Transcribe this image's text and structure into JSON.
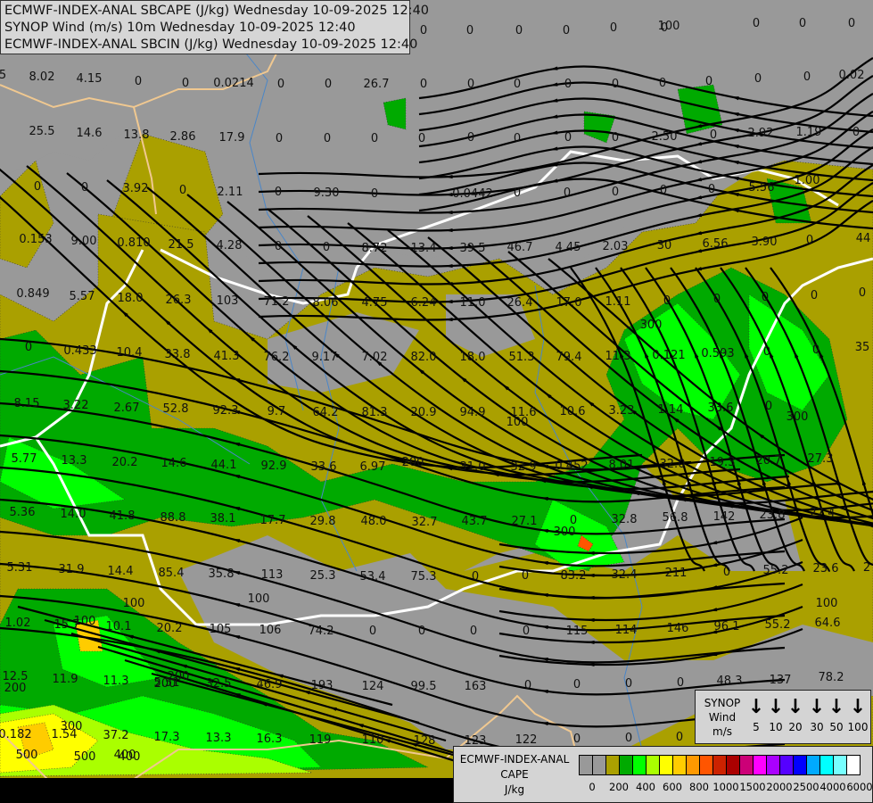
{
  "header": {
    "lines": [
      "ECMWF-INDEX-ANAL SBCAPE (J/kg) Wednesday 10-09-2025 12:40",
      "SYNOP Wind (m/s) 10m Wednesday 10-09-2025 12:40",
      "ECMWF-INDEX-ANAL SBCIN (J/kg) Wednesday 10-09-2025 12:40"
    ]
  },
  "wind_legend": {
    "title": [
      "SYNOP",
      "Wind",
      "m/s"
    ],
    "speeds": [
      "5",
      "10",
      "20",
      "30",
      "50",
      "100"
    ],
    "icon": "wind-arrow-down-icon"
  },
  "cape_legend": {
    "title": [
      "ECMWF-INDEX-ANAL",
      "CAPE",
      "J/kg"
    ],
    "colors": [
      "#999999",
      "#999999",
      "#aaa000",
      "#00aa00",
      "#00ff00",
      "#aaff00",
      "#ffff00",
      "#ffcc00",
      "#ff9900",
      "#ff5500",
      "#cc2200",
      "#aa0000",
      "#cc0077",
      "#ff00ff",
      "#aa00ff",
      "#5500ff",
      "#0000ff",
      "#00aaff",
      "#00ffff",
      "#77ffff",
      "#ffffff"
    ],
    "ticks": [
      "0",
      "200",
      "400",
      "600",
      "800",
      "1000",
      "1500",
      "2000",
      "2500",
      "4000",
      "6000"
    ]
  },
  "map": {
    "background_color": "#999999",
    "border_color": "#ffffff",
    "river_color": "#4a86c8",
    "coast_color": "#f0c890",
    "streamline_color": "#000000",
    "cin_labels": [
      "0",
      "0",
      "0",
      "0",
      "0",
      "0",
      "100",
      "0",
      "0",
      "0",
      "5",
      "8.02",
      "4.15",
      "0",
      "0",
      "0.0214",
      "0",
      "0",
      "26.7",
      "0",
      "0",
      "0",
      "0",
      "0",
      "0",
      "0",
      "0",
      "0",
      "0.02",
      "25.5",
      "14.6",
      "13.8",
      "2.86",
      "17.9",
      "0",
      "0",
      "0",
      "0",
      "0",
      "0",
      "0",
      "0",
      "2.50",
      "0",
      "2.92",
      "1.19",
      "0",
      "0",
      "0",
      "3.92",
      "0",
      "2.11",
      "0",
      "9.30",
      "0",
      "0.0442",
      "0",
      "0",
      "0",
      "0",
      "0",
      "5.56",
      "1.00",
      "0.153",
      "9.00",
      "0.810",
      "21.5",
      "4.28",
      "0",
      "0",
      "8.72",
      "13.4",
      "39.5",
      "46.7",
      "4.45",
      "2.03",
      "30",
      "6.56",
      "3.90",
      "0",
      "44",
      "0.849",
      "5.57",
      "18.0",
      "26.3",
      "103",
      "71.2",
      "8.06",
      "4.75",
      "6.24",
      "11.0",
      "26.4",
      "17.0",
      "1.11",
      "0",
      "0",
      "0",
      "0",
      "0",
      "0",
      "0.433",
      "10.4",
      "33.8",
      "41.3",
      "76.2",
      "9.17",
      "7.02",
      "82.0",
      "18.0",
      "51.3",
      "79.4",
      "11.3",
      "300",
      "0.121",
      "0.593",
      "0",
      "0",
      "35",
      "8.15",
      "3.22",
      "2.67",
      "52.8",
      "92.3",
      "9.7",
      "64.2",
      "81.3",
      "20.9",
      "94.9",
      "11.6",
      "100",
      "10.6",
      "3.23",
      "1.14",
      "33.6",
      "0",
      "300",
      "5.77",
      "13.3",
      "20.2",
      "14.6",
      "44.1",
      "92.9",
      "33.6",
      "6.97",
      "200",
      "31.0",
      "32.9",
      "0.452",
      "8.01",
      "32.0",
      "19.3",
      "20.7",
      "27.3",
      "5.36",
      "14.0",
      "41.8",
      "88.8",
      "38.1",
      "17.7",
      "29.8",
      "48.0",
      "32.7",
      "43.7",
      "27.1",
      "0",
      "300",
      "32.8",
      "56.8",
      "142",
      "23.8",
      "27.4",
      "5.31",
      "31.9",
      "14.4",
      "85.4",
      "35.8",
      "113",
      "25.3",
      "53.4",
      "75.3",
      "0",
      "0",
      "83.2",
      "32.4",
      "211",
      "0",
      "55.2",
      "23.6",
      "2",
      "100",
      "1.02",
      "15.7",
      "10.1",
      "20.2",
      "105",
      "106",
      "74.2",
      "0",
      "0",
      "0",
      "0",
      "115",
      "114",
      "146",
      "96.1",
      "55.2",
      "64.6",
      "100",
      "12.5",
      "200",
      "11.9",
      "11.3",
      "5.51",
      "32.5",
      "46.9",
      "193",
      "124",
      "99.5",
      "163",
      "0",
      "0",
      "0",
      "0",
      "48.3",
      "137",
      "78.2",
      "200",
      "0.182",
      "1.54",
      "37.2",
      "17.3",
      "13.3",
      "16.3",
      "119",
      "110",
      "128",
      "123",
      "122",
      "0",
      "0",
      "0",
      "0",
      "0",
      "30.8",
      "500",
      "400",
      "300",
      "400",
      "500",
      "100",
      "100",
      "200",
      "200"
    ]
  }
}
